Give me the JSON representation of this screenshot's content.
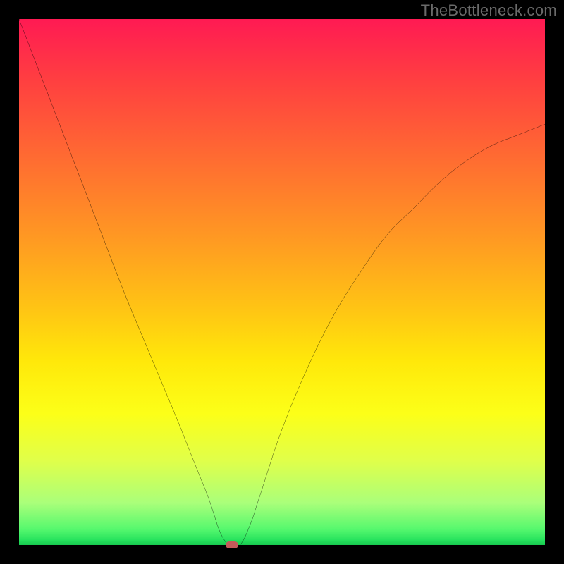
{
  "watermark": "TheBottleneck.com",
  "chart_data": {
    "type": "line",
    "title": "",
    "xlabel": "",
    "ylabel": "",
    "xlim": [
      0,
      100
    ],
    "ylim": [
      0,
      100
    ],
    "series": [
      {
        "name": "curve",
        "x": [
          0,
          5,
          10,
          15,
          20,
          25,
          30,
          32,
          34,
          36,
          37,
          38,
          39,
          40,
          42,
          44,
          46,
          50,
          55,
          60,
          65,
          70,
          75,
          80,
          85,
          90,
          95,
          100
        ],
        "values": [
          100,
          87,
          74,
          61,
          48,
          36,
          24,
          19,
          14,
          9,
          6,
          3,
          1,
          0,
          0,
          4,
          10,
          22,
          34,
          44,
          52,
          59,
          64,
          69,
          73,
          76,
          78,
          80
        ]
      }
    ],
    "marker": {
      "x": 40.5,
      "y": 0
    },
    "gradient_stops": [
      {
        "pct": 0,
        "color": "#ff1a53"
      },
      {
        "pct": 50,
        "color": "#ffd010"
      },
      {
        "pct": 80,
        "color": "#f5ff30"
      },
      {
        "pct": 100,
        "color": "#17c94f"
      }
    ]
  }
}
